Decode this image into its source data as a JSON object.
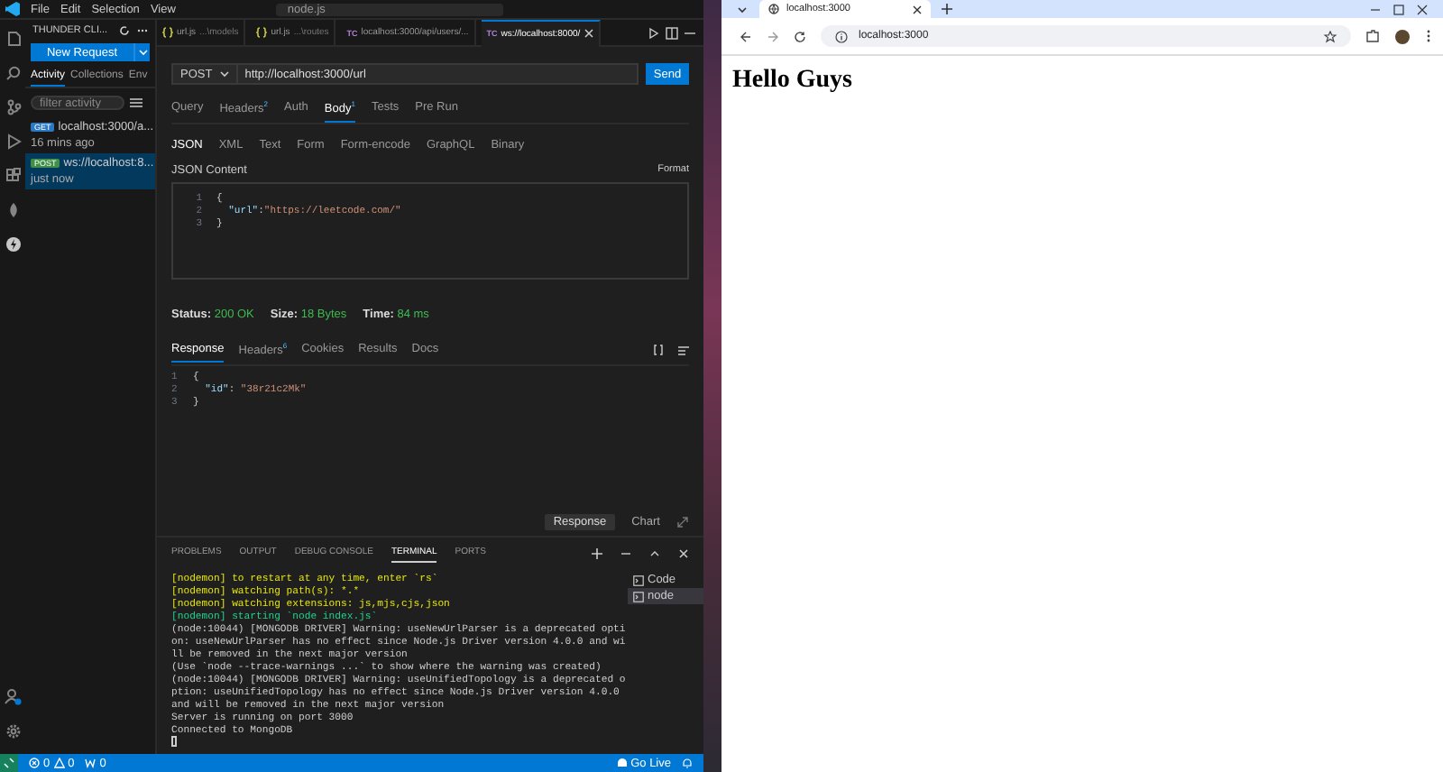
{
  "vscode": {
    "menu": [
      "File",
      "Edit",
      "Selection",
      "View"
    ],
    "command_center": "node.js",
    "sidebar": {
      "title": "THUNDER CLI...",
      "new_request": "New Request",
      "tabs": [
        {
          "label": "Activity",
          "selected": true
        },
        {
          "label": "Collections",
          "selected": false
        },
        {
          "label": "Env",
          "selected": false
        }
      ],
      "filter_placeholder": "filter activity",
      "items": [
        {
          "method": "GET",
          "color": "#2b79c2",
          "url": "localhost:3000/a...",
          "time": "16 mins ago",
          "selected": false
        },
        {
          "method": "POST",
          "color": "#3f8f48",
          "url": "ws://localhost:8...",
          "time": "just now",
          "selected": true
        }
      ]
    },
    "editor_tabs": [
      {
        "kind": "js",
        "label": "url.js",
        "detail": "...\\models",
        "selected": false
      },
      {
        "kind": "js",
        "label": "url.js",
        "detail": "...\\routes",
        "selected": false
      },
      {
        "kind": "thunder",
        "badge": "TC",
        "label": "localhost:3000/api/users/...",
        "selected": false
      },
      {
        "kind": "thunder",
        "badge": "TC",
        "label": "ws://localhost:8000/",
        "selected": true
      }
    ],
    "request": {
      "method": "POST",
      "url": "http://localhost:3000/url",
      "send": "Send",
      "tabs": [
        {
          "label": "Query",
          "selected": false
        },
        {
          "label": "Headers",
          "count": "2",
          "selected": false
        },
        {
          "label": "Auth",
          "selected": false
        },
        {
          "label": "Body",
          "count": "1",
          "selected": true
        },
        {
          "label": "Tests",
          "selected": false
        },
        {
          "label": "Pre Run",
          "selected": false
        }
      ],
      "body_tabs": [
        {
          "label": "JSON",
          "selected": true
        },
        {
          "label": "XML",
          "selected": false
        },
        {
          "label": "Text",
          "selected": false
        },
        {
          "label": "Form",
          "selected": false
        },
        {
          "label": "Form-encode",
          "selected": false
        },
        {
          "label": "GraphQL",
          "selected": false
        },
        {
          "label": "Binary",
          "selected": false
        }
      ],
      "content_label": "JSON Content",
      "format": "Format",
      "lines": [
        {
          "number": "1",
          "tokens": [
            {
              "kind": "punct",
              "text": "{"
            }
          ]
        },
        {
          "number": "2",
          "tokens": [
            {
              "kind": "key",
              "text": "  \"url\""
            },
            {
              "kind": "punct",
              "text": ":"
            },
            {
              "kind": "string",
              "text": "\"https://leetcode.com/\""
            }
          ]
        },
        {
          "number": "3",
          "tokens": [
            {
              "kind": "punct",
              "text": "}"
            }
          ]
        }
      ]
    },
    "response": {
      "status_label": "Status:",
      "status": "200 OK",
      "size_label": "Size:",
      "size": "18 Bytes",
      "time_label": "Time:",
      "time": "84 ms",
      "tabs": [
        {
          "label": "Response",
          "selected": true
        },
        {
          "label": "Headers",
          "count": "6",
          "selected": false
        },
        {
          "label": "Cookies",
          "selected": false
        },
        {
          "label": "Results",
          "selected": false
        },
        {
          "label": "Docs",
          "selected": false
        }
      ],
      "lines": [
        {
          "number": "1",
          "tokens": [
            {
              "kind": "punct",
              "text": "{"
            }
          ]
        },
        {
          "number": "2",
          "tokens": [
            {
              "kind": "key",
              "text": "  \"id\""
            },
            {
              "kind": "punct",
              "text": ": "
            },
            {
              "kind": "string",
              "text": "\"38r21c2Mk\""
            }
          ]
        },
        {
          "number": "3",
          "tokens": [
            {
              "kind": "punct",
              "text": "}"
            }
          ]
        }
      ],
      "views": [
        {
          "label": "Response",
          "selected": true
        },
        {
          "label": "Chart",
          "selected": false
        }
      ]
    },
    "panel": {
      "tabs": [
        {
          "label": "PROBLEMS",
          "selected": false
        },
        {
          "label": "OUTPUT",
          "selected": false
        },
        {
          "label": "DEBUG CONSOLE",
          "selected": false
        },
        {
          "label": "TERMINAL",
          "selected": true
        },
        {
          "label": "PORTS",
          "selected": false
        }
      ],
      "terminal_lines": [
        {
          "kind": "nodemon",
          "text": "[nodemon] to restart at any time, enter `rs`"
        },
        {
          "kind": "nodemon",
          "text": "[nodemon] watching path(s): *.*"
        },
        {
          "kind": "nodemon",
          "text": "[nodemon] watching extensions: js,mjs,cjs,json"
        },
        {
          "kind": "start",
          "text": "[nodemon] starting `node index.js`"
        },
        {
          "kind": "plain",
          "text": "(node:10044) [MONGODB DRIVER] Warning: useNewUrlParser is a deprecated opti"
        },
        {
          "kind": "plain",
          "text": "on: useNewUrlParser has no effect since Node.js Driver version 4.0.0 and wi"
        },
        {
          "kind": "plain",
          "text": "ll be removed in the next major version"
        },
        {
          "kind": "plain",
          "text": "(Use `node --trace-warnings ...` to show where the warning was created)"
        },
        {
          "kind": "plain",
          "text": "(node:10044) [MONGODB DRIVER] Warning: useUnifiedTopology is a deprecated o"
        },
        {
          "kind": "plain",
          "text": "ption: useUnifiedTopology has no effect since Node.js Driver version 4.0.0"
        },
        {
          "kind": "plain",
          "text": "and will be removed in the next major version"
        },
        {
          "kind": "plain",
          "text": "Server is running on port 3000"
        },
        {
          "kind": "plain",
          "text": "Connected to MongoDB"
        }
      ],
      "terminals": [
        {
          "label": "Code",
          "selected": false
        },
        {
          "label": "node",
          "selected": true
        }
      ]
    },
    "status_bar": {
      "errors": "0",
      "warnings": "0",
      "ports": "0",
      "go_live": "Go Live"
    }
  },
  "browser": {
    "tab": "localhost:3000",
    "address": "localhost:3000",
    "heading": "Hello Guys"
  }
}
